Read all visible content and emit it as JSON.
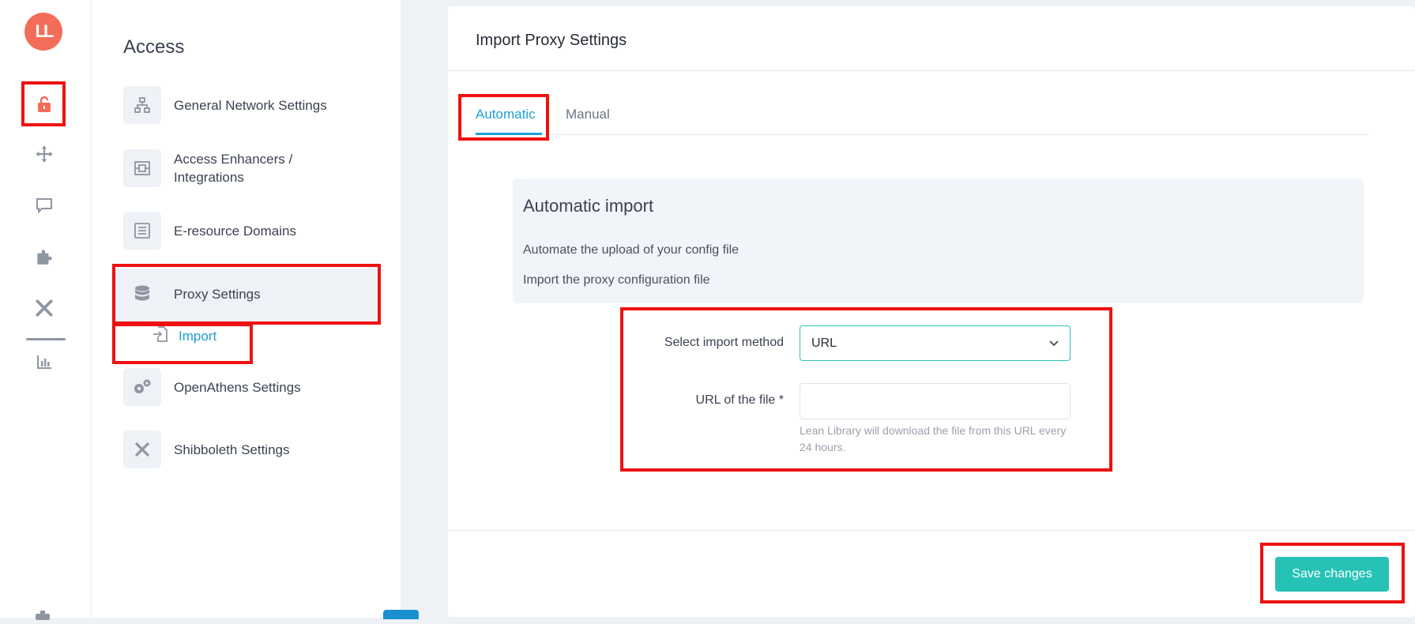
{
  "brand": {
    "logo_text": "LL",
    "accent": "#f46c5a"
  },
  "rail": {
    "items": [
      {
        "icon": "unlock-icon",
        "active": true
      },
      {
        "icon": "move-arrows-icon"
      },
      {
        "icon": "chat-bubble-icon"
      },
      {
        "icon": "puzzle-icon"
      },
      {
        "icon": "tools-icon"
      },
      {
        "icon": "bar-chart-icon"
      }
    ]
  },
  "subnav": {
    "title": "Access",
    "items": [
      {
        "label": "General Network Settings",
        "icon": "network-icon"
      },
      {
        "label": "Access Enhancers / Integrations",
        "icon": "integration-icon"
      },
      {
        "label": "E-resource Domains",
        "icon": "list-icon"
      },
      {
        "label": "Proxy Settings",
        "icon": "database-icon",
        "active": true
      },
      {
        "label": "OpenAthens Settings",
        "icon": "gears-icon"
      },
      {
        "label": "Shibboleth Settings",
        "icon": "tools-icon"
      }
    ],
    "sub_item": {
      "label": "Import",
      "icon": "file-import-icon"
    }
  },
  "main": {
    "title": "Import Proxy Settings",
    "tabs": [
      {
        "label": "Automatic",
        "active": true
      },
      {
        "label": "Manual"
      }
    ],
    "info": {
      "title": "Automatic import",
      "line1": "Automate the upload of your config file",
      "line2": "Import the proxy configuration file"
    },
    "form": {
      "method_label": "Select import method",
      "method_value": "URL",
      "url_label": "URL of the file *",
      "url_value": "",
      "url_help": "Lean Library will download the file from this URL every 24 hours."
    },
    "save_label": "Save changes"
  },
  "colors": {
    "teal": "#27c2b6",
    "link_blue": "#1da1d6",
    "highlight_red": "#ee1111"
  }
}
